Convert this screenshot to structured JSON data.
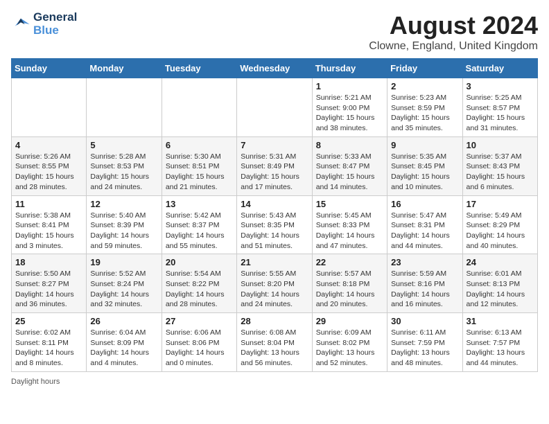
{
  "header": {
    "logo_line1": "General",
    "logo_line2": "Blue",
    "month_year": "August 2024",
    "location": "Clowne, England, United Kingdom"
  },
  "days_of_week": [
    "Sunday",
    "Monday",
    "Tuesday",
    "Wednesday",
    "Thursday",
    "Friday",
    "Saturday"
  ],
  "weeks": [
    [
      {
        "day": "",
        "sunrise": "",
        "sunset": "",
        "daylight": ""
      },
      {
        "day": "",
        "sunrise": "",
        "sunset": "",
        "daylight": ""
      },
      {
        "day": "",
        "sunrise": "",
        "sunset": "",
        "daylight": ""
      },
      {
        "day": "",
        "sunrise": "",
        "sunset": "",
        "daylight": ""
      },
      {
        "day": "1",
        "sunrise": "Sunrise: 5:21 AM",
        "sunset": "Sunset: 9:00 PM",
        "daylight": "Daylight: 15 hours and 38 minutes."
      },
      {
        "day": "2",
        "sunrise": "Sunrise: 5:23 AM",
        "sunset": "Sunset: 8:59 PM",
        "daylight": "Daylight: 15 hours and 35 minutes."
      },
      {
        "day": "3",
        "sunrise": "Sunrise: 5:25 AM",
        "sunset": "Sunset: 8:57 PM",
        "daylight": "Daylight: 15 hours and 31 minutes."
      }
    ],
    [
      {
        "day": "4",
        "sunrise": "Sunrise: 5:26 AM",
        "sunset": "Sunset: 8:55 PM",
        "daylight": "Daylight: 15 hours and 28 minutes."
      },
      {
        "day": "5",
        "sunrise": "Sunrise: 5:28 AM",
        "sunset": "Sunset: 8:53 PM",
        "daylight": "Daylight: 15 hours and 24 minutes."
      },
      {
        "day": "6",
        "sunrise": "Sunrise: 5:30 AM",
        "sunset": "Sunset: 8:51 PM",
        "daylight": "Daylight: 15 hours and 21 minutes."
      },
      {
        "day": "7",
        "sunrise": "Sunrise: 5:31 AM",
        "sunset": "Sunset: 8:49 PM",
        "daylight": "Daylight: 15 hours and 17 minutes."
      },
      {
        "day": "8",
        "sunrise": "Sunrise: 5:33 AM",
        "sunset": "Sunset: 8:47 PM",
        "daylight": "Daylight: 15 hours and 14 minutes."
      },
      {
        "day": "9",
        "sunrise": "Sunrise: 5:35 AM",
        "sunset": "Sunset: 8:45 PM",
        "daylight": "Daylight: 15 hours and 10 minutes."
      },
      {
        "day": "10",
        "sunrise": "Sunrise: 5:37 AM",
        "sunset": "Sunset: 8:43 PM",
        "daylight": "Daylight: 15 hours and 6 minutes."
      }
    ],
    [
      {
        "day": "11",
        "sunrise": "Sunrise: 5:38 AM",
        "sunset": "Sunset: 8:41 PM",
        "daylight": "Daylight: 15 hours and 3 minutes."
      },
      {
        "day": "12",
        "sunrise": "Sunrise: 5:40 AM",
        "sunset": "Sunset: 8:39 PM",
        "daylight": "Daylight: 14 hours and 59 minutes."
      },
      {
        "day": "13",
        "sunrise": "Sunrise: 5:42 AM",
        "sunset": "Sunset: 8:37 PM",
        "daylight": "Daylight: 14 hours and 55 minutes."
      },
      {
        "day": "14",
        "sunrise": "Sunrise: 5:43 AM",
        "sunset": "Sunset: 8:35 PM",
        "daylight": "Daylight: 14 hours and 51 minutes."
      },
      {
        "day": "15",
        "sunrise": "Sunrise: 5:45 AM",
        "sunset": "Sunset: 8:33 PM",
        "daylight": "Daylight: 14 hours and 47 minutes."
      },
      {
        "day": "16",
        "sunrise": "Sunrise: 5:47 AM",
        "sunset": "Sunset: 8:31 PM",
        "daylight": "Daylight: 14 hours and 44 minutes."
      },
      {
        "day": "17",
        "sunrise": "Sunrise: 5:49 AM",
        "sunset": "Sunset: 8:29 PM",
        "daylight": "Daylight: 14 hours and 40 minutes."
      }
    ],
    [
      {
        "day": "18",
        "sunrise": "Sunrise: 5:50 AM",
        "sunset": "Sunset: 8:27 PM",
        "daylight": "Daylight: 14 hours and 36 minutes."
      },
      {
        "day": "19",
        "sunrise": "Sunrise: 5:52 AM",
        "sunset": "Sunset: 8:24 PM",
        "daylight": "Daylight: 14 hours and 32 minutes."
      },
      {
        "day": "20",
        "sunrise": "Sunrise: 5:54 AM",
        "sunset": "Sunset: 8:22 PM",
        "daylight": "Daylight: 14 hours and 28 minutes."
      },
      {
        "day": "21",
        "sunrise": "Sunrise: 5:55 AM",
        "sunset": "Sunset: 8:20 PM",
        "daylight": "Daylight: 14 hours and 24 minutes."
      },
      {
        "day": "22",
        "sunrise": "Sunrise: 5:57 AM",
        "sunset": "Sunset: 8:18 PM",
        "daylight": "Daylight: 14 hours and 20 minutes."
      },
      {
        "day": "23",
        "sunrise": "Sunrise: 5:59 AM",
        "sunset": "Sunset: 8:16 PM",
        "daylight": "Daylight: 14 hours and 16 minutes."
      },
      {
        "day": "24",
        "sunrise": "Sunrise: 6:01 AM",
        "sunset": "Sunset: 8:13 PM",
        "daylight": "Daylight: 14 hours and 12 minutes."
      }
    ],
    [
      {
        "day": "25",
        "sunrise": "Sunrise: 6:02 AM",
        "sunset": "Sunset: 8:11 PM",
        "daylight": "Daylight: 14 hours and 8 minutes."
      },
      {
        "day": "26",
        "sunrise": "Sunrise: 6:04 AM",
        "sunset": "Sunset: 8:09 PM",
        "daylight": "Daylight: 14 hours and 4 minutes."
      },
      {
        "day": "27",
        "sunrise": "Sunrise: 6:06 AM",
        "sunset": "Sunset: 8:06 PM",
        "daylight": "Daylight: 14 hours and 0 minutes."
      },
      {
        "day": "28",
        "sunrise": "Sunrise: 6:08 AM",
        "sunset": "Sunset: 8:04 PM",
        "daylight": "Daylight: 13 hours and 56 minutes."
      },
      {
        "day": "29",
        "sunrise": "Sunrise: 6:09 AM",
        "sunset": "Sunset: 8:02 PM",
        "daylight": "Daylight: 13 hours and 52 minutes."
      },
      {
        "day": "30",
        "sunrise": "Sunrise: 6:11 AM",
        "sunset": "Sunset: 7:59 PM",
        "daylight": "Daylight: 13 hours and 48 minutes."
      },
      {
        "day": "31",
        "sunrise": "Sunrise: 6:13 AM",
        "sunset": "Sunset: 7:57 PM",
        "daylight": "Daylight: 13 hours and 44 minutes."
      }
    ]
  ],
  "footer": {
    "note": "Daylight hours"
  }
}
